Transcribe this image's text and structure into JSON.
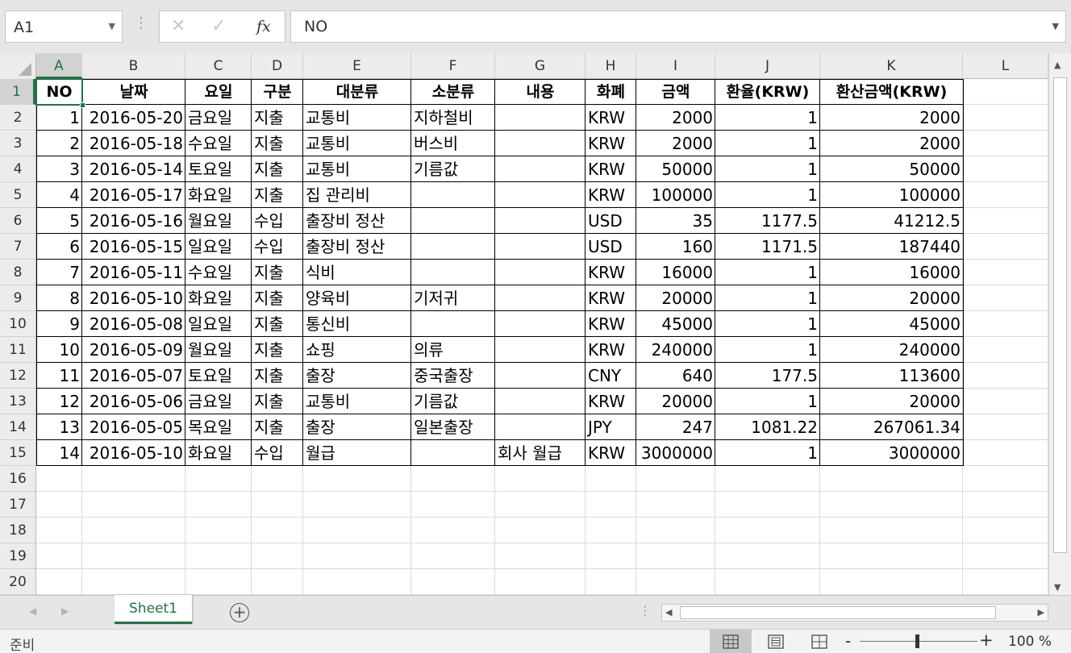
{
  "formula_bar": {
    "name_box": "A1",
    "cancel_icon": "✕",
    "enter_icon": "✓",
    "fx_label": "fx",
    "formula": "NO"
  },
  "columns": [
    "A",
    "B",
    "C",
    "D",
    "E",
    "F",
    "G",
    "H",
    "I",
    "J",
    "K",
    "L"
  ],
  "selected_column": "A",
  "rows": [
    "1",
    "2",
    "3",
    "4",
    "5",
    "6",
    "7",
    "8",
    "9",
    "10",
    "11",
    "12",
    "13",
    "14",
    "15",
    "16",
    "17",
    "18",
    "19",
    "20"
  ],
  "selected_row": "1",
  "table": {
    "headers": [
      "NO",
      "날짜",
      "요일",
      "구분",
      "대분류",
      "소분류",
      "내용",
      "화폐",
      "금액",
      "환율(KRW)",
      "환산금액(KRW)"
    ],
    "rows": [
      [
        "1",
        "2016-05-20",
        "금요일",
        "지출",
        "교통비",
        "지하철비",
        "",
        "KRW",
        "2000",
        "1",
        "2000"
      ],
      [
        "2",
        "2016-05-18",
        "수요일",
        "지출",
        "교통비",
        "버스비",
        "",
        "KRW",
        "2000",
        "1",
        "2000"
      ],
      [
        "3",
        "2016-05-14",
        "토요일",
        "지출",
        "교통비",
        "기름값",
        "",
        "KRW",
        "50000",
        "1",
        "50000"
      ],
      [
        "4",
        "2016-05-17",
        "화요일",
        "지출",
        "집 관리비",
        "",
        "",
        "KRW",
        "100000",
        "1",
        "100000"
      ],
      [
        "5",
        "2016-05-16",
        "월요일",
        "수입",
        "출장비 정산",
        "",
        "",
        "USD",
        "35",
        "1177.5",
        "41212.5"
      ],
      [
        "6",
        "2016-05-15",
        "일요일",
        "수입",
        "출장비 정산",
        "",
        "",
        "USD",
        "160",
        "1171.5",
        "187440"
      ],
      [
        "7",
        "2016-05-11",
        "수요일",
        "지출",
        "식비",
        "",
        "",
        "KRW",
        "16000",
        "1",
        "16000"
      ],
      [
        "8",
        "2016-05-10",
        "화요일",
        "지출",
        "양육비",
        "기저귀",
        "",
        "KRW",
        "20000",
        "1",
        "20000"
      ],
      [
        "9",
        "2016-05-08",
        "일요일",
        "지출",
        "통신비",
        "",
        "",
        "KRW",
        "45000",
        "1",
        "45000"
      ],
      [
        "10",
        "2016-05-09",
        "월요일",
        "지출",
        "쇼핑",
        "의류",
        "",
        "KRW",
        "240000",
        "1",
        "240000"
      ],
      [
        "11",
        "2016-05-07",
        "토요일",
        "지출",
        "출장",
        "중국출장",
        "",
        "CNY",
        "640",
        "177.5",
        "113600"
      ],
      [
        "12",
        "2016-05-06",
        "금요일",
        "지출",
        "교통비",
        "기름값",
        "",
        "KRW",
        "20000",
        "1",
        "20000"
      ],
      [
        "13",
        "2016-05-05",
        "목요일",
        "지출",
        "출장",
        "일본출장",
        "",
        "JPY",
        "247",
        "1081.22",
        "267061.34"
      ],
      [
        "14",
        "2016-05-10",
        "화요일",
        "수입",
        "월급",
        "",
        "회사 월급",
        "KRW",
        "3000000",
        "1",
        "3000000"
      ]
    ]
  },
  "sheet_tabs": {
    "active": "Sheet1",
    "add_icon": "+"
  },
  "status": {
    "text": "준비",
    "zoom": "100 %",
    "zoom_minus": "-",
    "zoom_plus": "+"
  },
  "colors": {
    "accent": "#217346",
    "gridline": "#dadada",
    "header_bg": "#ececec"
  }
}
